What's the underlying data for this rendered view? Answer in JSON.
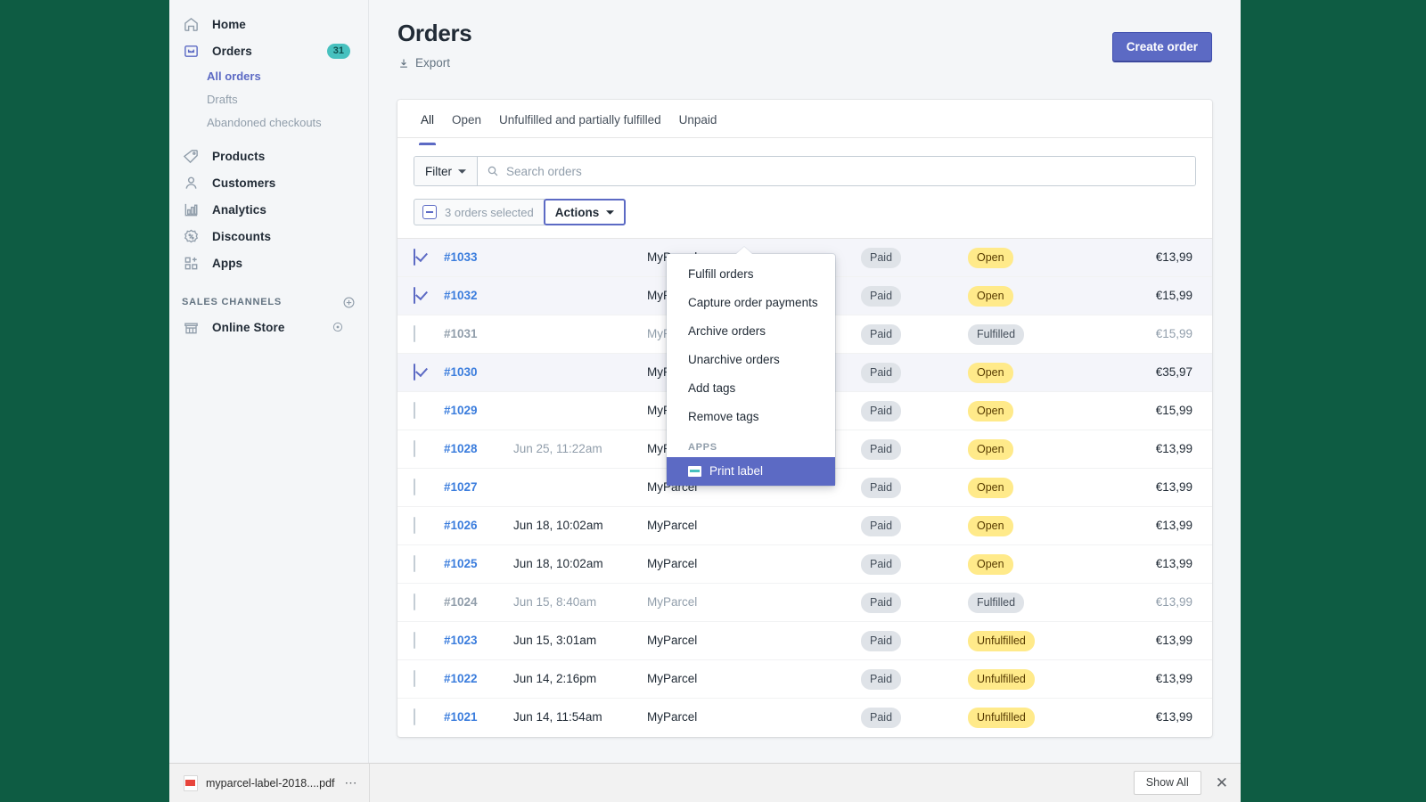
{
  "theme": {
    "accent": "#5c6ac4",
    "badge_teal": "#47c1bf",
    "status_yellow": "#ffea8a",
    "status_grey": "#dfe3e8",
    "link_blue": "#3b7ddd",
    "desktop_green": "#0e5c43"
  },
  "sidebar": {
    "items": [
      {
        "label": "Home",
        "icon": "home-icon",
        "badge": ""
      },
      {
        "label": "Orders",
        "icon": "orders-inbox-icon",
        "badge": "31"
      },
      {
        "label": "Products",
        "icon": "tag-icon",
        "badge": ""
      },
      {
        "label": "Customers",
        "icon": "person-icon",
        "badge": ""
      },
      {
        "label": "Analytics",
        "icon": "bar-chart-icon",
        "badge": ""
      },
      {
        "label": "Discounts",
        "icon": "discount-percent-icon",
        "badge": ""
      },
      {
        "label": "Apps",
        "icon": "apps-grid-plus-icon",
        "badge": ""
      }
    ],
    "orders_subnav": [
      {
        "label": "All orders",
        "selected": true
      },
      {
        "label": "Drafts",
        "selected": false
      },
      {
        "label": "Abandoned checkouts",
        "selected": false
      }
    ],
    "sales_channels": {
      "title": "SALES CHANNELS",
      "add_icon": "plus-circle-icon",
      "items": [
        {
          "label": "Online Store",
          "icon": "storefront-icon",
          "action_icon": "eye-icon"
        }
      ]
    }
  },
  "header": {
    "title": "Orders",
    "export_label": "Export",
    "export_icon": "download-arrow-icon",
    "create_order_label": "Create order"
  },
  "tabs": [
    {
      "label": "All",
      "active": true
    },
    {
      "label": "Open",
      "active": false
    },
    {
      "label": "Unfulfilled and partially fulfilled",
      "active": false
    },
    {
      "label": "Unpaid",
      "active": false
    }
  ],
  "filters": {
    "filter_label": "Filter",
    "filter_caret_icon": "chevron-down-icon",
    "search_icon": "search-icon",
    "search_placeholder": "Search orders",
    "search_value": ""
  },
  "bulk": {
    "selected_label": "3 orders selected",
    "indeterminate_icon": "minus-checkbox-icon",
    "actions_label": "Actions",
    "actions_caret_icon": "chevron-down-icon"
  },
  "actions_menu": {
    "items": [
      {
        "label": "Fulfill orders"
      },
      {
        "label": "Capture order payments"
      },
      {
        "label": "Archive orders"
      },
      {
        "label": "Unarchive orders"
      },
      {
        "label": "Add tags"
      },
      {
        "label": "Remove tags"
      }
    ],
    "section_label": "APPS",
    "app_items": [
      {
        "label": "Print label",
        "icon": "shipping-label-icon",
        "highlighted": true
      }
    ]
  },
  "table": {
    "rows": [
      {
        "order": "#1033",
        "date": "",
        "customer": "MyParcel",
        "payment": "Paid",
        "fulfillment": "Open",
        "total": "€13,99",
        "checked": true,
        "dimmed": false
      },
      {
        "order": "#1032",
        "date": "",
        "customer": "MyParcel",
        "payment": "Paid",
        "fulfillment": "Open",
        "total": "€15,99",
        "checked": true,
        "dimmed": false
      },
      {
        "order": "#1031",
        "date": "",
        "customer": "MyParcel",
        "payment": "Paid",
        "fulfillment": "Fulfilled",
        "total": "€15,99",
        "checked": false,
        "dimmed": true
      },
      {
        "order": "#1030",
        "date": "",
        "customer": "MyParcel",
        "payment": "Paid",
        "fulfillment": "Open",
        "total": "€35,97",
        "checked": true,
        "dimmed": false
      },
      {
        "order": "#1029",
        "date": "",
        "customer": "MyParcel",
        "payment": "Paid",
        "fulfillment": "Open",
        "total": "€15,99",
        "checked": false,
        "dimmed": false
      },
      {
        "order": "#1028",
        "date": "Jun 25, 11:22am",
        "customer": "MyParcel",
        "payment": "Paid",
        "fulfillment": "Open",
        "total": "€13,99",
        "checked": false,
        "dimmed": false
      },
      {
        "order": "#1027",
        "date": "",
        "customer": "MyParcel",
        "payment": "Paid",
        "fulfillment": "Open",
        "total": "€13,99",
        "checked": false,
        "dimmed": false
      },
      {
        "order": "#1026",
        "date": "Jun 18, 10:02am",
        "customer": "MyParcel",
        "payment": "Paid",
        "fulfillment": "Open",
        "total": "€13,99",
        "checked": false,
        "dimmed": false
      },
      {
        "order": "#1025",
        "date": "Jun 18, 10:02am",
        "customer": "MyParcel",
        "payment": "Paid",
        "fulfillment": "Open",
        "total": "€13,99",
        "checked": false,
        "dimmed": false
      },
      {
        "order": "#1024",
        "date": "Jun 15, 8:40am",
        "customer": "MyParcel",
        "payment": "Paid",
        "fulfillment": "Fulfilled",
        "total": "€13,99",
        "checked": false,
        "dimmed": true
      },
      {
        "order": "#1023",
        "date": "Jun 15, 3:01am",
        "customer": "MyParcel",
        "payment": "Paid",
        "fulfillment": "Unfulfilled",
        "total": "€13,99",
        "checked": false,
        "dimmed": false
      },
      {
        "order": "#1022",
        "date": "Jun 14, 2:16pm",
        "customer": "MyParcel",
        "payment": "Paid",
        "fulfillment": "Unfulfilled",
        "total": "€13,99",
        "checked": false,
        "dimmed": false
      },
      {
        "order": "#1021",
        "date": "Jun 14, 11:54am",
        "customer": "MyParcel",
        "payment": "Paid",
        "fulfillment": "Unfulfilled",
        "total": "€13,99",
        "checked": false,
        "dimmed": false
      }
    ]
  },
  "download_bar": {
    "file_name": "myparcel-label-2018....pdf",
    "file_icon": "pdf-file-icon",
    "menu_icon": "more-dots-icon",
    "show_all_label": "Show All",
    "close_icon": "close-icon"
  }
}
